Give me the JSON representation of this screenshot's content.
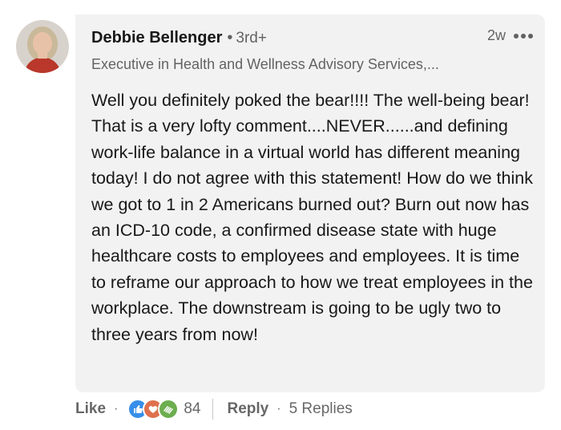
{
  "comment": {
    "author": "Debbie Bellenger",
    "connection_degree": "3rd+",
    "headline": "Executive in Health and Wellness Advisory Services,...",
    "timestamp": "2w",
    "body": "Well you definitely poked the bear!!!! The well-being bear! That is a very lofty comment....NEVER......and defining work-life balance in a virtual world has different meaning today! I do not agree with this statement! How do we think we got to 1 in 2 Americans burned out? Burn out now has an ICD-10 code, a confirmed disease state with huge healthcare costs to employees and employees. It is time to reframe our approach to how we treat employees in the workplace. The downstream is going to be ugly two to three years from now!"
  },
  "actions": {
    "like_label": "Like",
    "reaction_count": "84",
    "reply_label": "Reply",
    "replies_label": "5 Replies",
    "reactions": [
      "like-icon",
      "love-icon",
      "support-icon"
    ]
  },
  "colors": {
    "bubble": "#f2f2f2",
    "like": "#378fe9",
    "love": "#df704d",
    "support": "#6dae4f"
  }
}
